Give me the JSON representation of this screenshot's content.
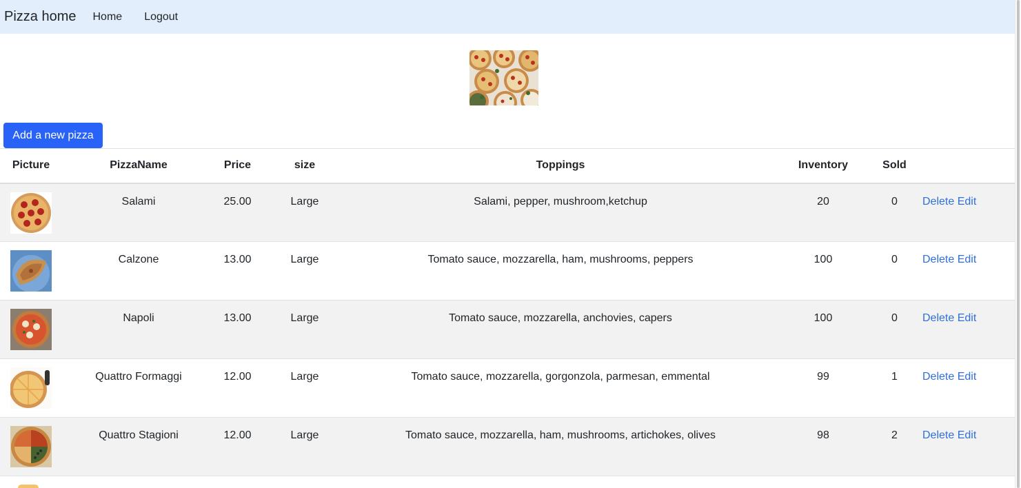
{
  "navbar": {
    "brand": "Pizza home",
    "links": [
      "Home",
      "Logout"
    ]
  },
  "hero_image": "pizza-collection-image",
  "add_button_label": "Add a new pizza",
  "table": {
    "headers": [
      "Picture",
      "PizzaName",
      "Price",
      "size",
      "Toppings",
      "Inventory",
      "Sold",
      ""
    ],
    "rows": [
      {
        "name": "Salami",
        "price": "25.00",
        "size": "Large",
        "toppings": "Salami, pepper, mushroom,ketchup",
        "inventory": "20",
        "sold": "0",
        "delete": "Delete",
        "edit": "Edit"
      },
      {
        "name": "Calzone",
        "price": "13.00",
        "size": "Large",
        "toppings": "Tomato sauce, mozzarella, ham, mushrooms, peppers",
        "inventory": "100",
        "sold": "0",
        "delete": "Delete",
        "edit": "Edit"
      },
      {
        "name": "Napoli",
        "price": "13.00",
        "size": "Large",
        "toppings": "Tomato sauce, mozzarella, anchovies, capers",
        "inventory": "100",
        "sold": "0",
        "delete": "Delete",
        "edit": "Edit"
      },
      {
        "name": "Quattro Formaggi",
        "price": "12.00",
        "size": "Large",
        "toppings": "Tomato sauce, mozzarella, gorgonzola, parmesan, emmental",
        "inventory": "99",
        "sold": "1",
        "delete": "Delete",
        "edit": "Edit"
      },
      {
        "name": "Quattro Stagioni",
        "price": "12.00",
        "size": "Large",
        "toppings": "Tomato sauce, mozzarella, ham, mushrooms, artichokes, olives",
        "inventory": "98",
        "sold": "2",
        "delete": "Delete",
        "edit": "Edit"
      }
    ]
  }
}
